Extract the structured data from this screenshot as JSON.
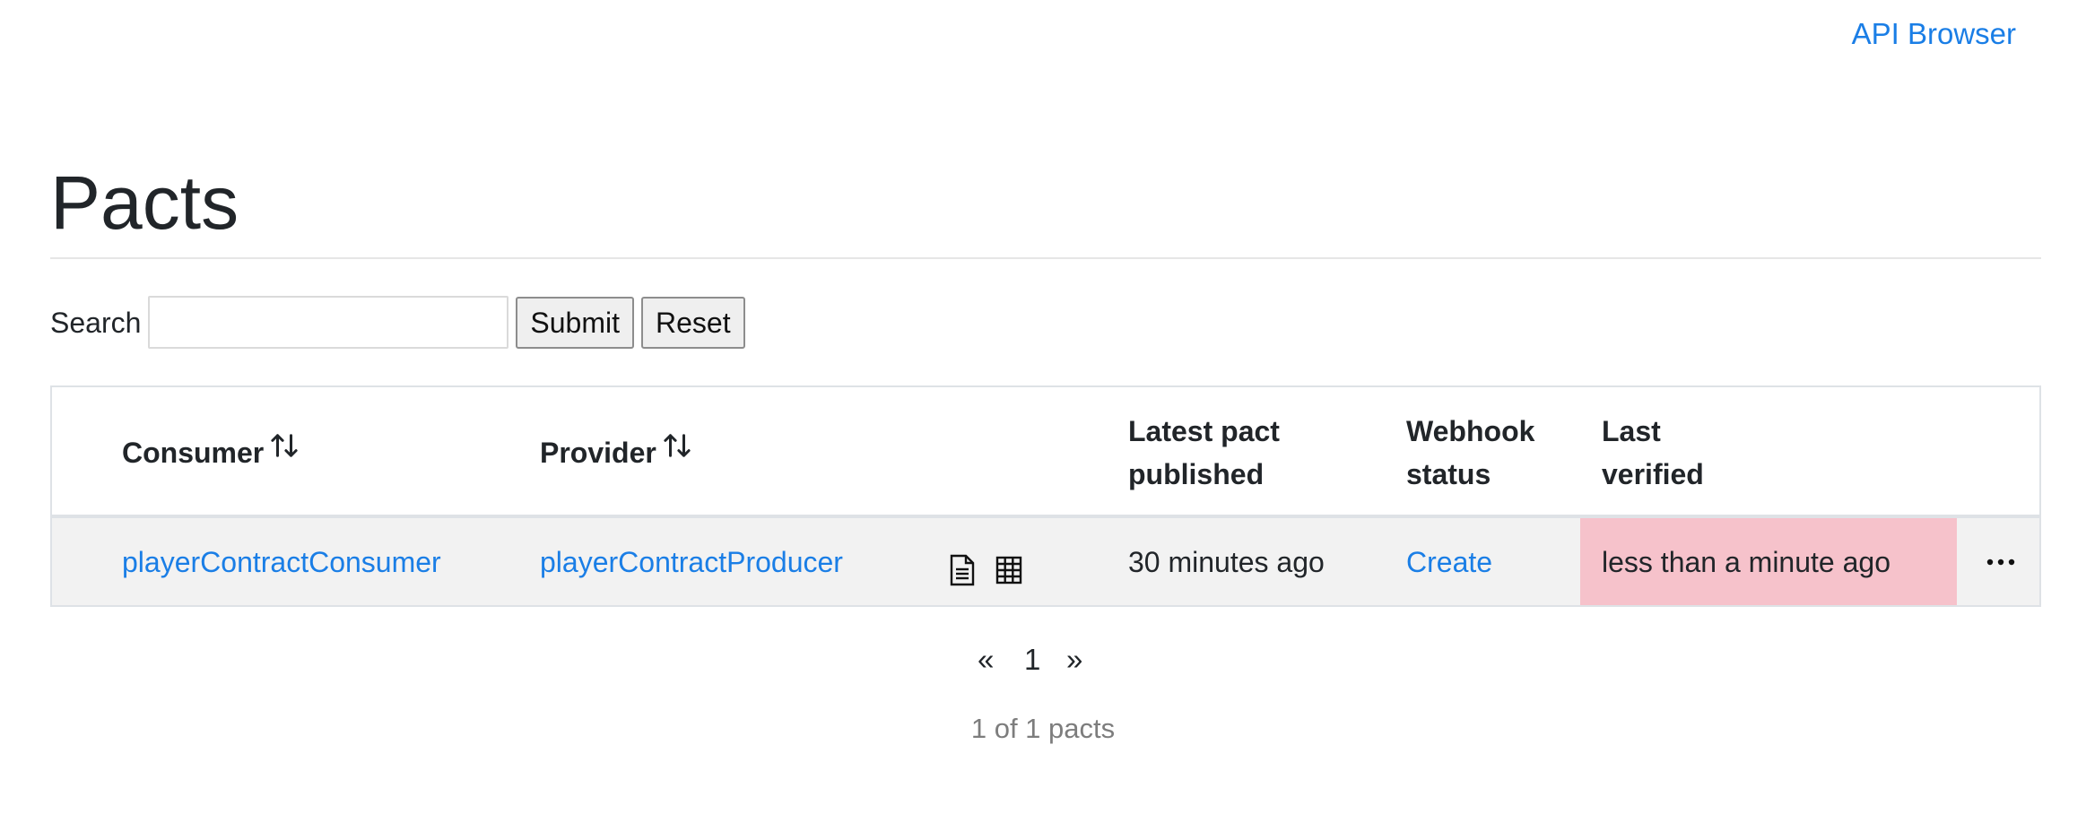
{
  "header": {
    "api_browser_link": "API Browser"
  },
  "page": {
    "title": "Pacts"
  },
  "search": {
    "label": "Search",
    "value": "",
    "placeholder": "",
    "submit_label": "Submit",
    "reset_label": "Reset"
  },
  "table": {
    "columns": {
      "consumer": "Consumer",
      "provider": "Provider",
      "latest_pact_line1": "Latest pact",
      "latest_pact_line2": "published",
      "webhook_line1": "Webhook",
      "webhook_line2": "status",
      "last_verified_line1": "Last",
      "last_verified_line2": "verified"
    },
    "rows": [
      {
        "consumer": "playerContractConsumer",
        "provider": "playerContractProducer",
        "latest_pact_published": "30 minutes ago",
        "webhook_status": "Create",
        "last_verified": "less than a minute ago",
        "last_verified_color": "#f6c2cb",
        "actions_icon": "ellipsis-icon",
        "icons": [
          "document-icon",
          "table-grid-icon"
        ]
      }
    ]
  },
  "pagination": {
    "prev": "«",
    "current_page": "1",
    "next": "»",
    "summary": "1 of 1 pacts"
  },
  "colors": {
    "link": "#1a7ee6",
    "verified_failed_bg": "#f6c2cb",
    "row_bg": "#f2f2f2"
  }
}
